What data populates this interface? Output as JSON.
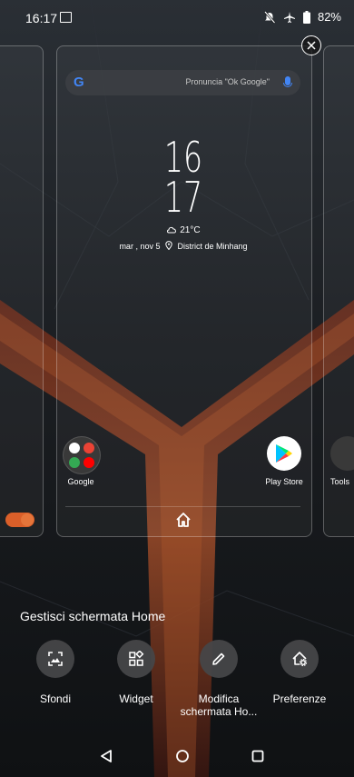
{
  "status_bar": {
    "time": "16:17",
    "battery": "82%",
    "icons": [
      "gallery-icon",
      "mute-icon",
      "airplane-icon",
      "battery-icon"
    ]
  },
  "search": {
    "brand": "G",
    "placeholder": "Pronuncia \"Ok Google\""
  },
  "clock": {
    "hour": "16",
    "minute": "17"
  },
  "weather": {
    "temp": "21°C",
    "date": "mar , nov 5",
    "location": "District de Minhang"
  },
  "dock": {
    "google_folder": "Google",
    "play_store": "Play Store",
    "tools": "Tools"
  },
  "manage": {
    "title": "Gestisci schermata Home",
    "actions": [
      {
        "label": "Sfondi",
        "icon": "wallpaper-icon"
      },
      {
        "label": "Widget",
        "icon": "widgets-icon"
      },
      {
        "label": "Modifica schermata Ho...",
        "icon": "pencil-icon"
      },
      {
        "label": "Preferenze",
        "icon": "home-settings-icon"
      }
    ]
  },
  "colors": {
    "accent_toggle": "#e5632a",
    "google_blue": "#4285F4",
    "background": "#14171b"
  }
}
